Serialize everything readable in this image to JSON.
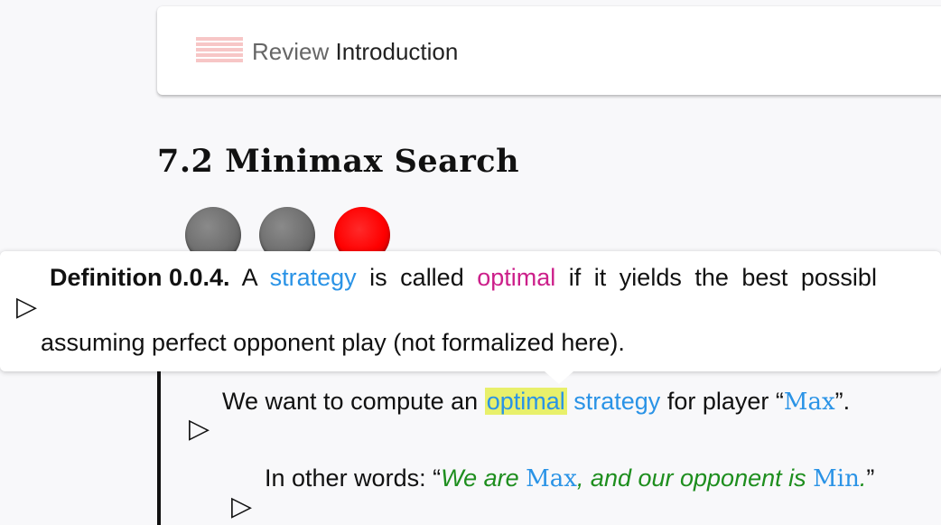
{
  "review": {
    "prefix": "Review",
    "title": "Introduction",
    "icon": "list-icon"
  },
  "section": {
    "title": "7.2 Minimax Search"
  },
  "progress_dots": [
    {
      "state": "done",
      "color": "#777777"
    },
    {
      "state": "done",
      "color": "#777777"
    },
    {
      "state": "current",
      "color": "#ff0000"
    }
  ],
  "definition": {
    "label": "Definition 0.0.4.",
    "word_a": "A",
    "strategy": "strategy",
    "is_called": "is called",
    "optimal": "optimal",
    "line1_rest": "if it yields the best possibl",
    "line2": "assuming perfect opponent play (not formalized here)."
  },
  "paragraph1": {
    "text_a": "We want to compute an",
    "optimal": "optimal",
    "strategy": "strategy",
    "text_b": "for player “",
    "max": "Max",
    "text_c": "”."
  },
  "paragraph2": {
    "text_a": "In other words: “",
    "em_a": "We are ",
    "max": "Max",
    "em_b": ", and our opponent is ",
    "min": "Min",
    "em_c": ".",
    "text_b": "”"
  },
  "colors": {
    "link": "#2a93e6",
    "defined_term": "#cc1f8a",
    "emphasis": "#1e8e1e",
    "highlight": "#e8f06b"
  }
}
